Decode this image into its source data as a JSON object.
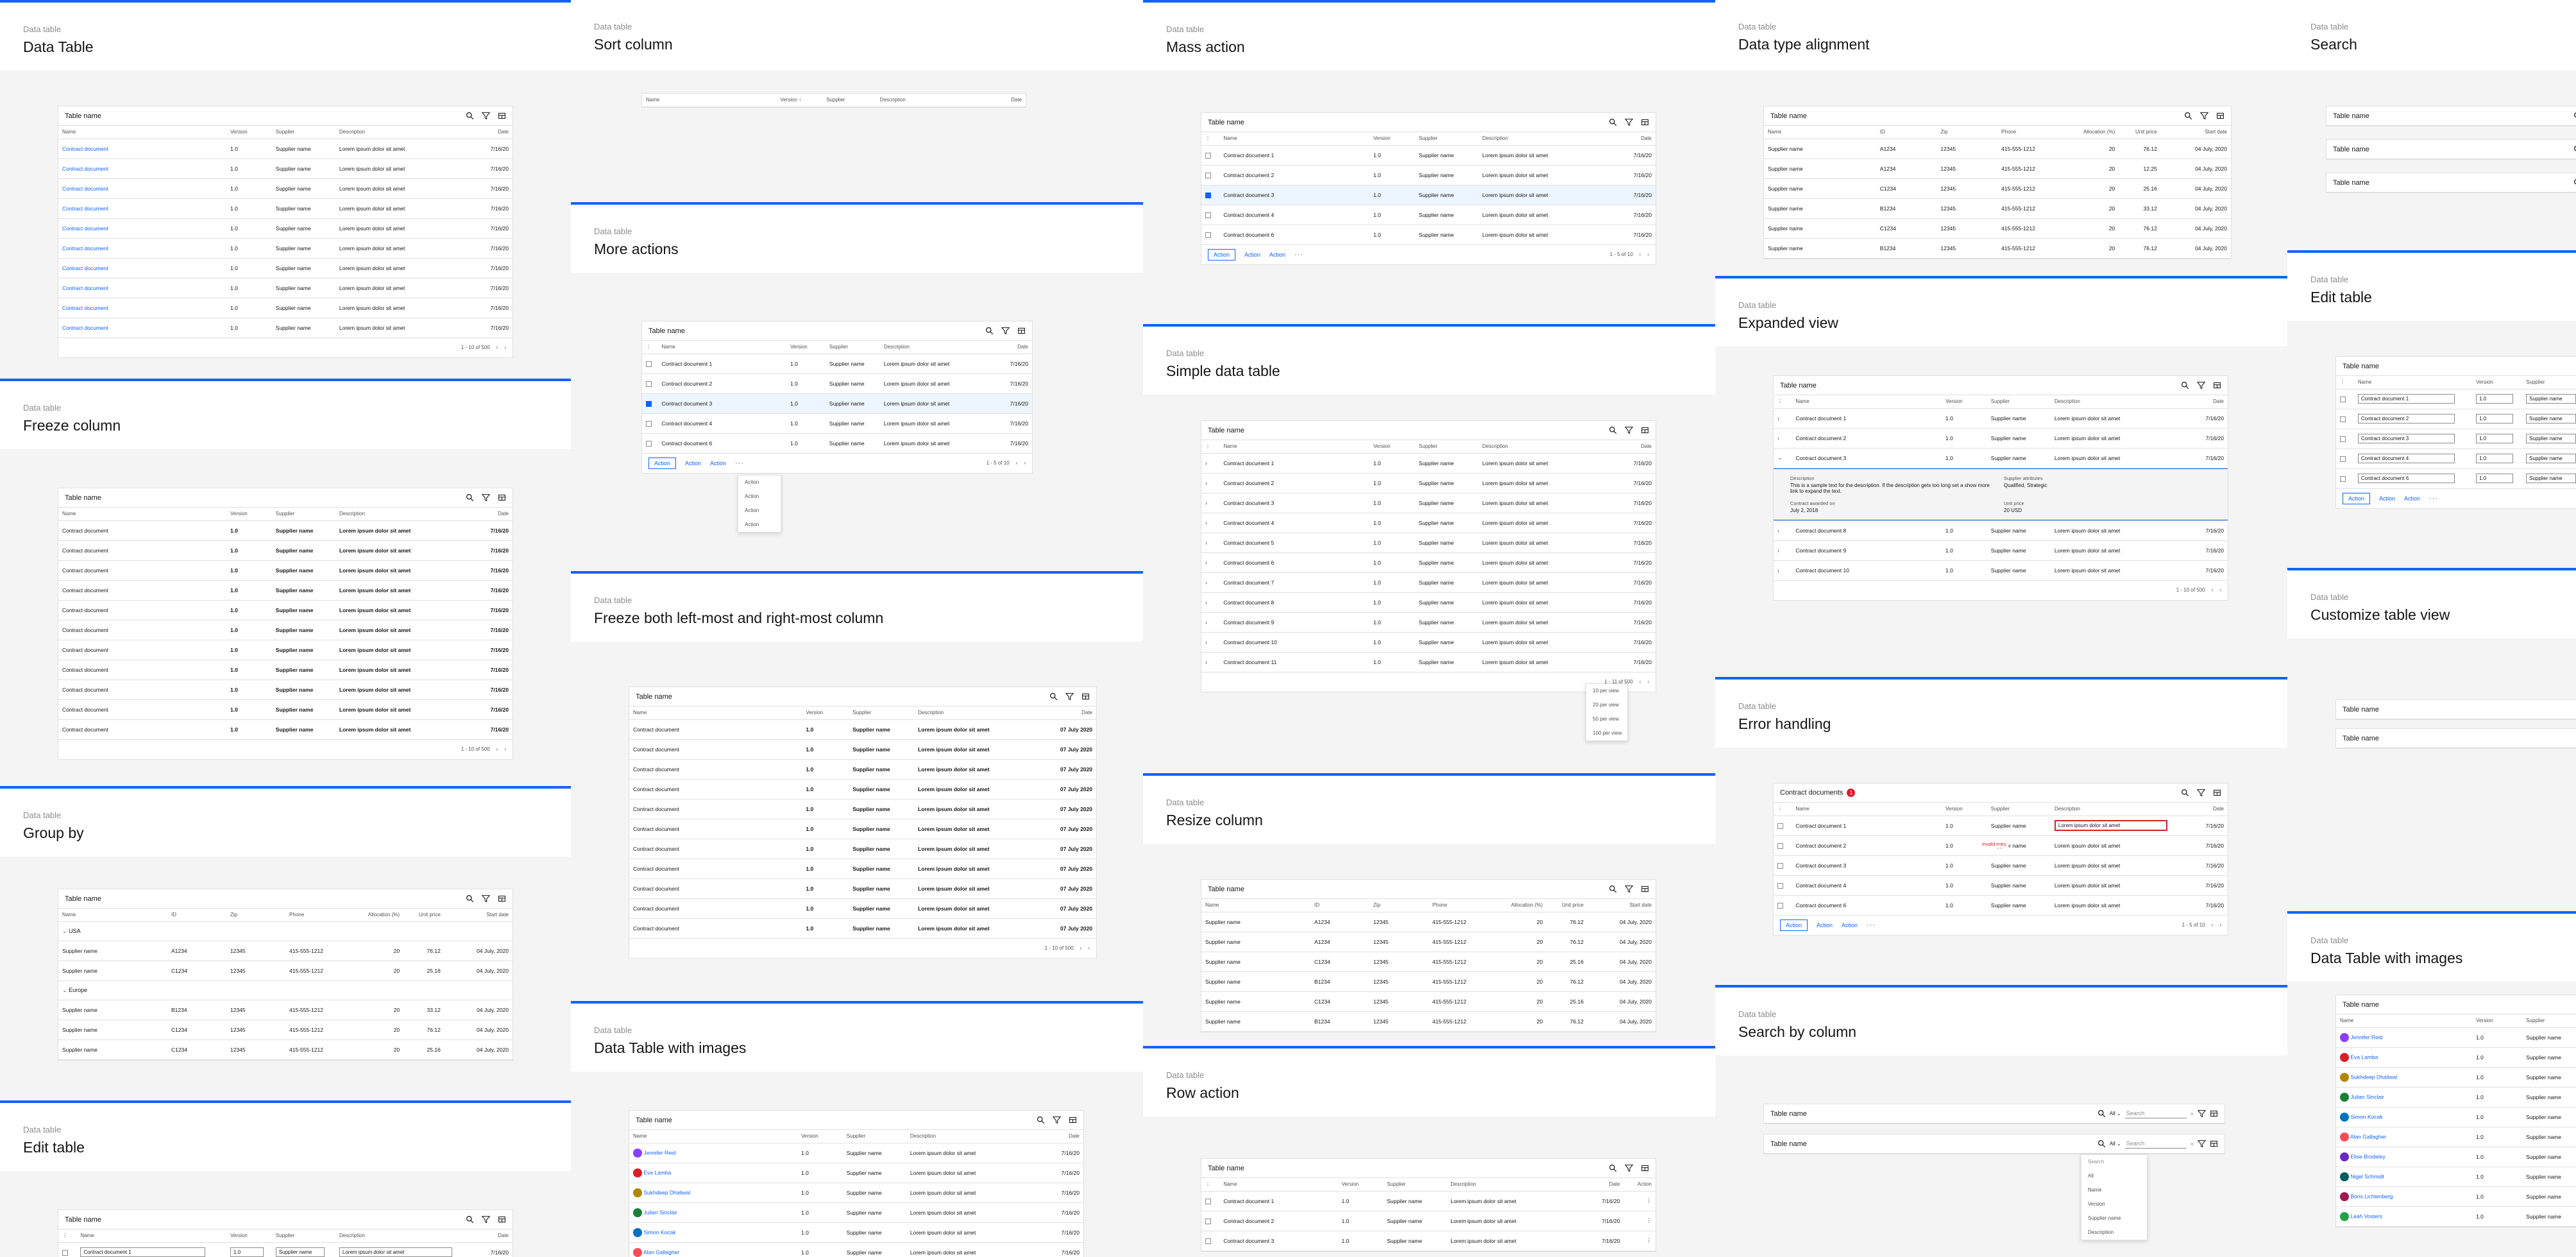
{
  "kicker": "Data table",
  "table_name": "Table name",
  "icons": [
    "search-icon",
    "filter-icon",
    "settings-icon"
  ],
  "colors": {
    "accent": "#0f62fe",
    "error": "#da1e28",
    "background": "#f4f4f4"
  },
  "common": {
    "name": "Name",
    "version": "Version",
    "supplier": "Supplier",
    "description": "Description",
    "date": "Date",
    "supplier_name": "Supplier name",
    "lorem": "Lorem ipsum dolor sit amet",
    "date_val": "7/16/20",
    "version_val": "1.0",
    "contract_document": "Contract document",
    "action": "Action",
    "overflow": "···",
    "id": "ID",
    "zip": "Zip",
    "phone": "Phone",
    "allocation": "Allocation (%)",
    "unit_price": "Unit price",
    "start_date": "Start date",
    "prev": "‹",
    "next": "›",
    "row_action": "Action",
    "drag": "⋮"
  },
  "panels": {
    "data_table": {
      "title": "Data Table",
      "pager": "1 - 10 of 500"
    },
    "sort_column": {
      "title": "Sort column",
      "sorted_col": "Version ↑"
    },
    "mass_action": {
      "title": "Mass action",
      "pager": "1 - 5 of 10"
    },
    "type_alignment": {
      "title": "Data type alignment"
    },
    "search": {
      "title": "Search"
    },
    "freeze_column": {
      "title": "Freeze column",
      "pager": "1 - 10 of 500"
    },
    "more_actions": {
      "title": "More actions",
      "pager": "1 - 5 of 10",
      "menu": [
        "Action",
        "Action",
        "Action",
        "Action"
      ]
    },
    "expanded_view": {
      "title": "Expanded view",
      "pager": "1 - 10 of 500",
      "desc_label": "Description",
      "desc_text": "This is a sample text for the description. If the description gets too long set a show more link to expand the text.",
      "attr_label": "Supplier attributes",
      "attr_text": "Qualified, Strategic",
      "awarded_label": "Contract awarded on",
      "awarded_text": "July 2, 2018",
      "unit_label": "Unit price",
      "unit_text": "20 USD"
    },
    "edit_table_right": {
      "title": "Edit table"
    },
    "simple_table": {
      "title": "Simple data table",
      "pager": "1 - 11 of 500",
      "per_page": [
        "10 per view",
        "20 per view",
        "50 per view",
        "100 per view"
      ]
    },
    "freeze_both": {
      "title": "Freeze both left-most and right-most column",
      "pager": "1 - 10 of 500",
      "date_long": "07 July 2020"
    },
    "customize_view": {
      "title": "Customize table view"
    },
    "error_handling": {
      "title": "Error handling",
      "table": "Contract documents",
      "badge": "1",
      "error": "Invalid entry",
      "pager": "1 - 5 of 10"
    },
    "group_by": {
      "title": "Group by",
      "groups": [
        "USA",
        "Europe"
      ],
      "date_long": "04 July, 2020"
    },
    "resize_column": {
      "title": "Resize column",
      "date_long": "04 July, 2020"
    },
    "images_mid": {
      "title": "Data Table with images"
    },
    "images_right": {
      "title": "Data Table with images"
    },
    "search_by_column": {
      "title": "Search by column",
      "all": "All",
      "placeholder": "Search",
      "options_header": "Search",
      "options": [
        "All",
        "Name",
        "Version",
        "Supplier name",
        "Description"
      ]
    },
    "row_action": {
      "title": "Row action"
    },
    "edit_table_left": {
      "title": "Edit table",
      "cell": "Contract document 1"
    }
  },
  "people": [
    "Jennifer Reid",
    "Eva Lamba",
    "Sukhdeep Dhaliwal",
    "Julian Sinclair",
    "Simon Kocak",
    "Alan Gallagher",
    "Elise Brodeley",
    "Nigel Schmidt",
    "Boris Lichtenberg",
    "Leah Vosters"
  ],
  "avatar_colors": [
    "#8a3ffc",
    "#da1e28",
    "#b28600",
    "#198038",
    "#0072c3",
    "#fa4d56",
    "#6929c4",
    "#005d5d",
    "#9f1853",
    "#24a148"
  ],
  "alignment_rows": [
    {
      "id": "A1234",
      "price": "76.12"
    },
    {
      "id": "A1234",
      "price": "12.25"
    },
    {
      "id": "C1234",
      "price": "25.16"
    },
    {
      "id": "B1234",
      "price": "33.12"
    },
    {
      "id": "C1234",
      "price": "76.12"
    },
    {
      "id": "B1234",
      "price": "76.12"
    }
  ],
  "zip_val": "12345",
  "phone_val": "415-555-1212",
  "alloc_val": "20",
  "date_july": "04 July, 2020"
}
